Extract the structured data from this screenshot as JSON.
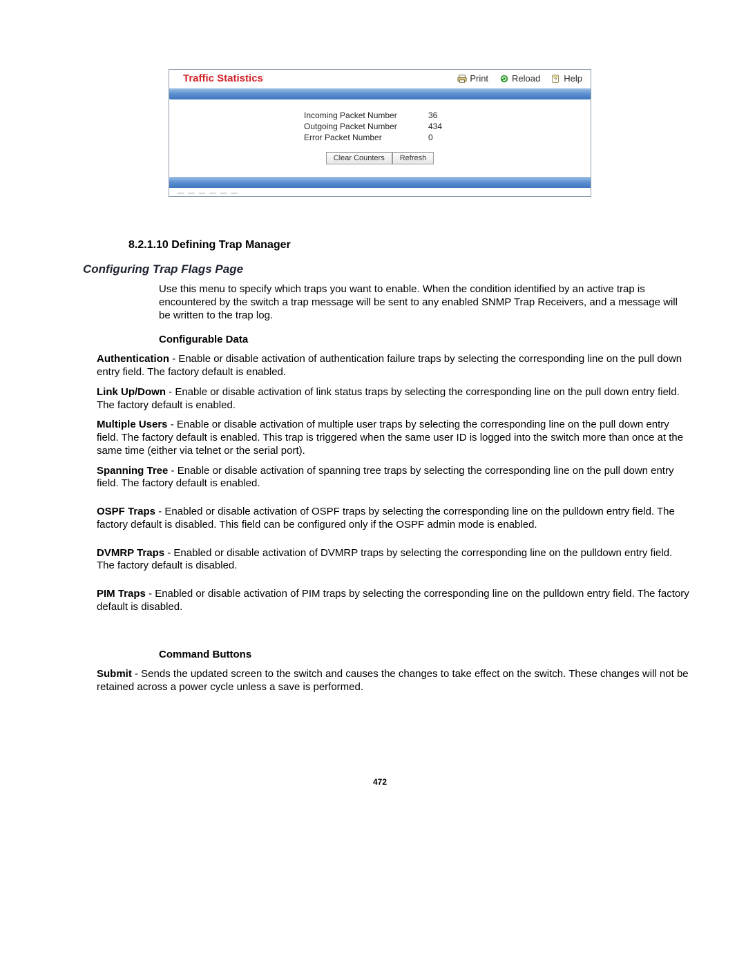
{
  "panel": {
    "title": "Traffic Statistics",
    "actions": {
      "print": "Print",
      "reload": "Reload",
      "help": "Help"
    },
    "stats": [
      {
        "label": "Incoming Packet Number",
        "value": "36"
      },
      {
        "label": "Outgoing Packet Number",
        "value": "434"
      },
      {
        "label": "Error Packet Number",
        "value": "0"
      }
    ],
    "buttons": {
      "clear": "Clear Counters",
      "refresh": "Refresh"
    }
  },
  "doc": {
    "section_number": "8.2.1.10",
    "section_title": "Defining Trap Manager",
    "subtitle": "Configuring Trap Flags Page",
    "intro": "Use this menu to specify which traps you want to enable. When the condition identified by an active trap is encountered by the switch a trap message will be sent to any enabled SNMP Trap Receivers, and a message will be written to the trap log.",
    "configurable_heading": "Configurable Data",
    "items": [
      {
        "term": "Authentication",
        "desc": " - Enable or disable activation of authentication failure traps by selecting the corresponding line on the pull down entry field. The factory default is enabled."
      },
      {
        "term": "Link Up/Down",
        "desc": " - Enable or disable activation of link status traps by selecting the corresponding line on the pull down entry field. The factory default is enabled."
      },
      {
        "term": "Multiple Users",
        "desc": " - Enable or disable activation of multiple user traps by selecting the corresponding line on the pull down entry field. The factory default is enabled. This trap is triggered when the same user ID is logged into the switch more than once at the same time (either via telnet or the serial port)."
      },
      {
        "term": "Spanning Tree",
        "desc": " - Enable or disable activation of spanning tree traps by selecting the corresponding line on the pull down entry field. The factory default is enabled."
      },
      {
        "term": "OSPF Traps",
        "desc": " - Enabled or disable activation of OSPF traps by selecting the corresponding line on the pulldown entry field. The factory default is disabled. This field can be configured only if the OSPF admin mode is enabled."
      },
      {
        "term": "DVMRP Traps",
        "desc": " - Enabled or disable activation of DVMRP traps by selecting the corresponding line on the pulldown entry field. The factory default is disabled."
      },
      {
        "term": "PIM Traps",
        "desc": " - Enabled or disable activation of PIM traps by selecting the corresponding line on the pulldown entry field. The factory default is disabled."
      }
    ],
    "command_heading": "Command Buttons",
    "command_items": [
      {
        "term": "Submit",
        "desc": " - Sends the updated screen to the switch and causes the changes to take effect on the switch. These changes will not be retained across a power cycle unless a save is performed."
      }
    ],
    "page_number": "472"
  }
}
